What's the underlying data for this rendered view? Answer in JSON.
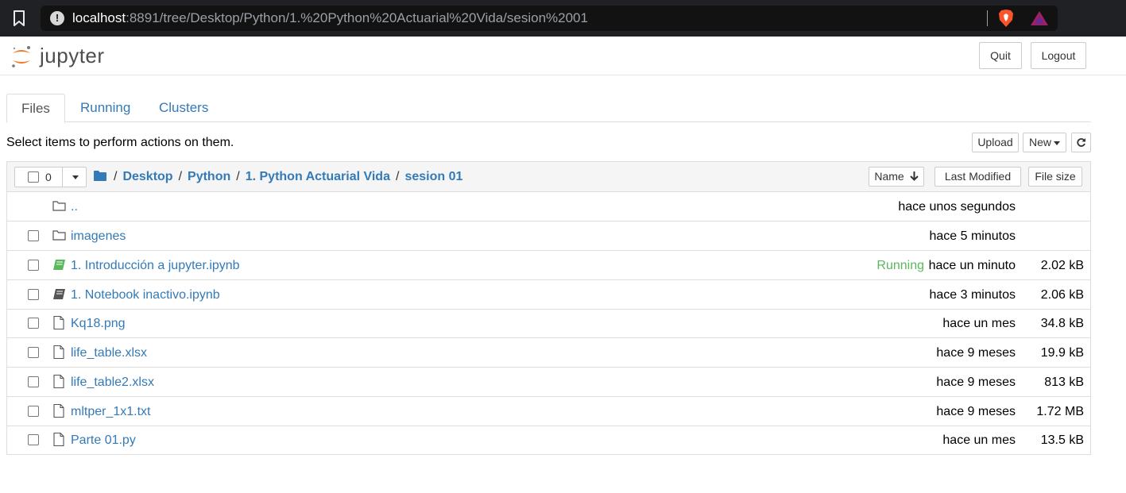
{
  "browser": {
    "url_host": "localhost",
    "url_rest": ":8891/tree/Desktop/Python/1.%20Python%20Actuarial%20Vida/sesion%2001"
  },
  "header": {
    "logo_text": "jupyter",
    "quit_label": "Quit",
    "logout_label": "Logout"
  },
  "tabs": [
    {
      "label": "Files"
    },
    {
      "label": "Running"
    },
    {
      "label": "Clusters"
    }
  ],
  "toolbar": {
    "instructions": "Select items to perform actions on them.",
    "upload_label": "Upload",
    "new_label": "New"
  },
  "list_header": {
    "selected_count": "0",
    "breadcrumbs": [
      "Desktop",
      "Python",
      "1. Python Actuarial Vida",
      "sesion 01"
    ],
    "sort_name_label": "Name",
    "sort_modified_label": "Last Modified",
    "sort_size_label": "File size"
  },
  "rows": [
    {
      "type": "parent",
      "name": "..",
      "status": "",
      "modified": "hace unos segundos",
      "size": ""
    },
    {
      "type": "folder",
      "name": "imagenes",
      "status": "",
      "modified": "hace 5 minutos",
      "size": ""
    },
    {
      "type": "notebook-running",
      "name": "1. Introducción a jupyter.ipynb",
      "status": "Running",
      "modified": "hace un minuto",
      "size": "2.02 kB"
    },
    {
      "type": "notebook",
      "name": "1. Notebook inactivo.ipynb",
      "status": "",
      "modified": "hace 3 minutos",
      "size": "2.06 kB"
    },
    {
      "type": "file",
      "name": "Kq18.png",
      "status": "",
      "modified": "hace un mes",
      "size": "34.8 kB"
    },
    {
      "type": "file",
      "name": "life_table.xlsx",
      "status": "",
      "modified": "hace 9 meses",
      "size": "19.9 kB"
    },
    {
      "type": "file",
      "name": "life_table2.xlsx",
      "status": "",
      "modified": "hace 9 meses",
      "size": "813 kB"
    },
    {
      "type": "file",
      "name": "mltper_1x1.txt",
      "status": "",
      "modified": "hace 9 meses",
      "size": "1.72 MB"
    },
    {
      "type": "file",
      "name": "Parte 01.py",
      "status": "",
      "modified": "hace un mes",
      "size": "13.5 kB"
    }
  ],
  "colors": {
    "link": "#337ab7",
    "running": "#5cb85c",
    "jupyter_orange": "#f37726"
  }
}
